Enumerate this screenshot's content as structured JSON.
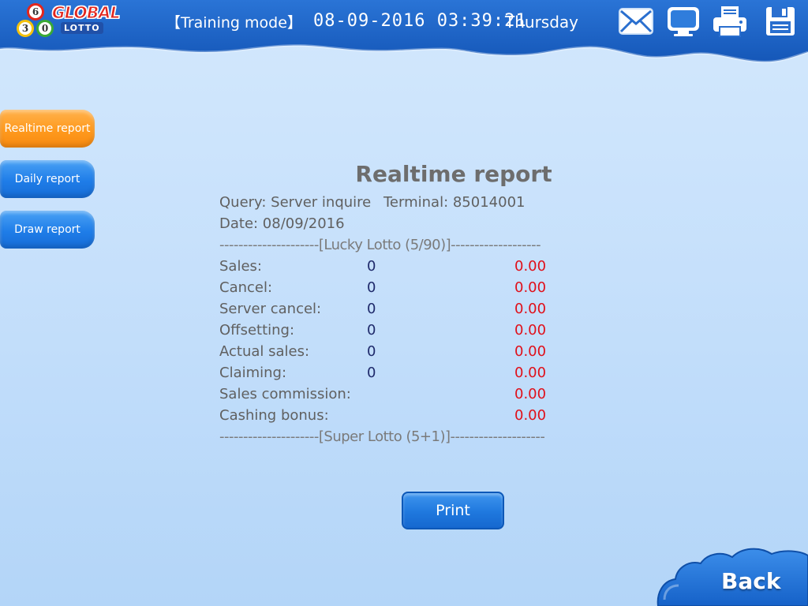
{
  "header": {
    "logo": {
      "balls": [
        "6",
        "3",
        "0"
      ],
      "top": "GLOBAL",
      "bottom": "LOTTO"
    },
    "mode": "【Training mode】",
    "datetime": "08-09-2016 03:39:21",
    "weekday": "Thursday",
    "icons": [
      "mail-icon",
      "monitor-icon",
      "printer-icon",
      "save-icon"
    ]
  },
  "sidebar": {
    "items": [
      {
        "label": "Realtime report",
        "active": true
      },
      {
        "label": "Daily report",
        "active": false
      },
      {
        "label": "Draw report",
        "active": false
      }
    ]
  },
  "report": {
    "title": "Realtime report",
    "query_label": "Query: Server inquire",
    "terminal_label": "Terminal: 85014001",
    "date_label": "Date: 08/09/2016",
    "section1": "---------------------[Lucky Lotto (5/90)]-------------------",
    "rows": [
      {
        "label": "Sales:",
        "count": "0",
        "amount": "0.00"
      },
      {
        "label": "Cancel:",
        "count": "0",
        "amount": "0.00"
      },
      {
        "label": "Server cancel:",
        "count": "0",
        "amount": "0.00"
      },
      {
        "label": "Offsetting:",
        "count": "0",
        "amount": "0.00"
      },
      {
        "label": "Actual sales:",
        "count": "0",
        "amount": "0.00"
      },
      {
        "label": "Claiming:",
        "count": "0",
        "amount": "0.00"
      },
      {
        "label": "Sales commission:",
        "count": "",
        "amount": "0.00"
      },
      {
        "label": "Cashing bonus:",
        "count": "",
        "amount": "0.00"
      }
    ],
    "section2": "---------------------[Super Lotto (5+1)]--------------------"
  },
  "actions": {
    "print_label": "Print",
    "back_label": "Back"
  },
  "colors": {
    "header_blue": "#1c63c4",
    "active_tab": "#ff9a1e",
    "tab_blue": "#1f7de8",
    "count_color": "#1f2a6b",
    "amount_color": "#e0101a"
  }
}
